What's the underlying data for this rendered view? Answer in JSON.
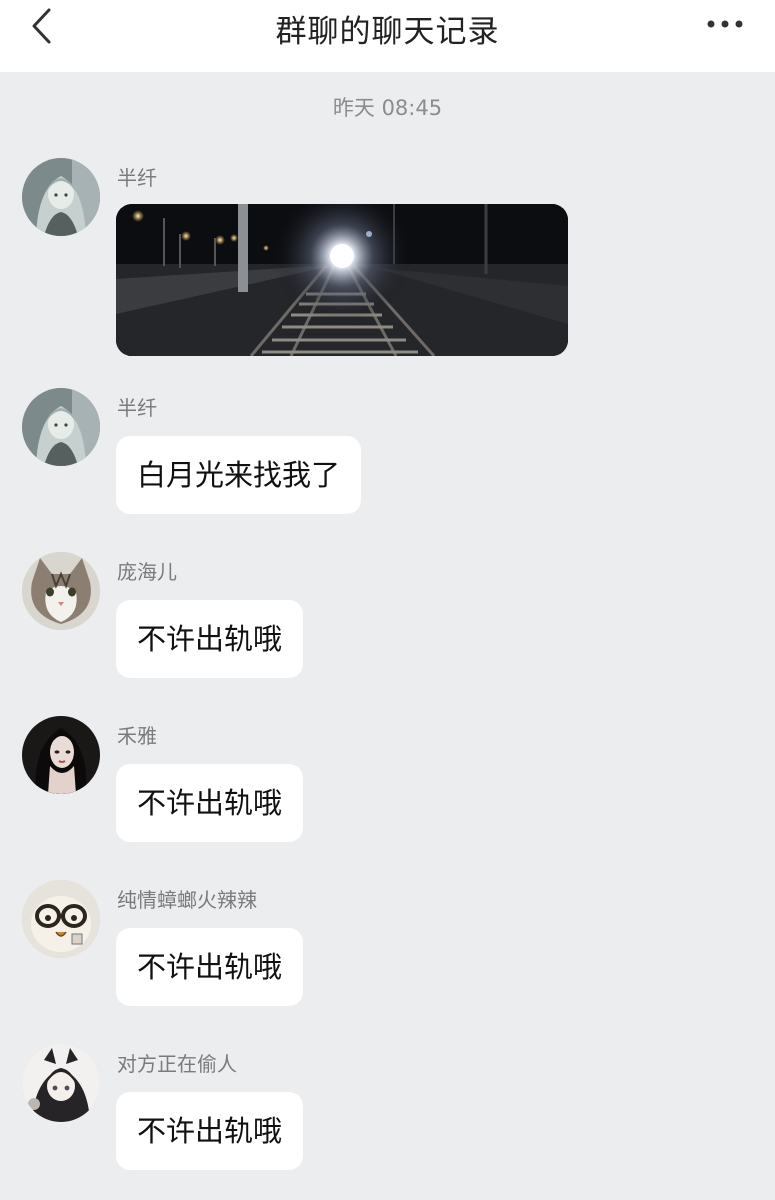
{
  "header": {
    "title": "群聊的聊天记录",
    "back_icon": "chevron-left-icon",
    "more_icon": "more-dots-icon"
  },
  "timestamp": "昨天 08:45",
  "messages": [
    {
      "sender": "半纤",
      "type": "image",
      "image": "night-railway-tunnel-photo",
      "avatar": "anime-girl-avatar"
    },
    {
      "sender": "半纤",
      "type": "text",
      "text": "白月光来找我了",
      "avatar": "anime-girl-avatar"
    },
    {
      "sender": "庞海儿",
      "type": "text",
      "text": "不许出轨哦",
      "avatar": "cat-avatar"
    },
    {
      "sender": "禾雅",
      "type": "text",
      "text": "不许出轨哦",
      "avatar": "woman-portrait-avatar"
    },
    {
      "sender": "纯情蟑螂火辣辣",
      "type": "text",
      "text": "不许出轨哦",
      "avatar": "cartoon-face-avatar"
    },
    {
      "sender": "对方正在偷人",
      "type": "text",
      "text": "不许出轨哦",
      "avatar": "anime-boy-avatar"
    }
  ],
  "colors": {
    "background": "#ecedef",
    "bubble": "#ffffff",
    "header": "#ffffff",
    "sender_text": "#7b7b7b"
  }
}
